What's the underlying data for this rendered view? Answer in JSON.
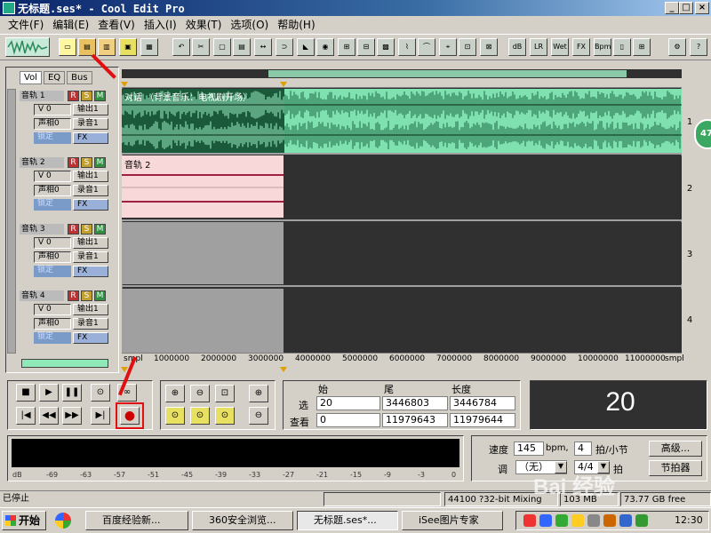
{
  "window": {
    "title": "无标题.ses* - Cool Edit Pro",
    "min": "_",
    "max": "□",
    "close": "×"
  },
  "menu": [
    "文件(F)",
    "编辑(E)",
    "查看(V)",
    "插入(I)",
    "效果(T)",
    "选项(O)",
    "帮助(H)"
  ],
  "tabs": [
    "Vol",
    "EQ",
    "Bus"
  ],
  "tracks": [
    {
      "name": "音轨 1",
      "vol": "V 0",
      "pan": "声相0",
      "out": "输出1",
      "rec": "录音1",
      "lock": "锁定",
      "fx": "FX",
      "num": "1",
      "clip": "对话 （背景音乐：电视剧开场）"
    },
    {
      "name": "音轨 2",
      "vol": "V 0",
      "pan": "声相0",
      "out": "输出1",
      "rec": "录音1",
      "lock": "锁定",
      "fx": "FX",
      "num": "2",
      "clip": "音轨 2"
    },
    {
      "name": "音轨 3",
      "vol": "V 0",
      "pan": "声相0",
      "out": "输出1",
      "rec": "录音1",
      "lock": "锁定",
      "fx": "FX",
      "num": "3"
    },
    {
      "name": "音轨 4",
      "vol": "V 0",
      "pan": "声相0",
      "out": "输出1",
      "rec": "录音1",
      "lock": "锁定",
      "fx": "FX",
      "num": "4"
    }
  ],
  "rsm": {
    "r": "R",
    "s": "S",
    "m": "M"
  },
  "ruler": [
    "smpl",
    "1000000",
    "2000000",
    "3000000",
    "4000000",
    "5000000",
    "6000000",
    "7000000",
    "8000000",
    "9000000",
    "10000000",
    "11000000",
    "smpl"
  ],
  "side_badge": "47",
  "selection": {
    "hdr_start": "始",
    "hdr_end": "尾",
    "hdr_len": "长度",
    "sel_label": "选",
    "view_label": "查看",
    "sel_start": "20",
    "sel_end": "3446803",
    "sel_len": "3446784",
    "view_start": "0",
    "view_end": "11979643",
    "view_len": "11979644"
  },
  "time_display": "20",
  "tempo": {
    "speed_label": "速度",
    "speed": "145",
    "bpm": "bpm,",
    "beats": "4",
    "beats_label": "拍/小节",
    "key_label": "调",
    "key": "（无）",
    "sig": "4/4",
    "sig_label": "拍",
    "advanced": "高级...",
    "metronome": "节拍器"
  },
  "meter_ticks": [
    "dB",
    "-69",
    "-63",
    "-57",
    "-51",
    "-45",
    "-39",
    "-33",
    "-27",
    "-21",
    "-15",
    "-9",
    "-3",
    "0"
  ],
  "status": {
    "state": "已停止",
    "format": "44100 ?32-bit Mixing",
    "size": "103 MB",
    "free": "73.77 GB free"
  },
  "taskbar": {
    "start": "开始",
    "tasks": [
      "百度经验新...",
      "360安全浏览...",
      "无标题.ses*...",
      "iSee图片专家"
    ],
    "clock": "12:30"
  },
  "watermark": "Bai 经验",
  "colors": {
    "wave1": "#7fe0b0",
    "wave1_dark": "#1a5a3a",
    "wave2_bg": "#f8d8d8",
    "wave2_line": "#a02040",
    "empty": "#303030",
    "gray": "#a0a0a0",
    "record_box": "#e01010"
  }
}
